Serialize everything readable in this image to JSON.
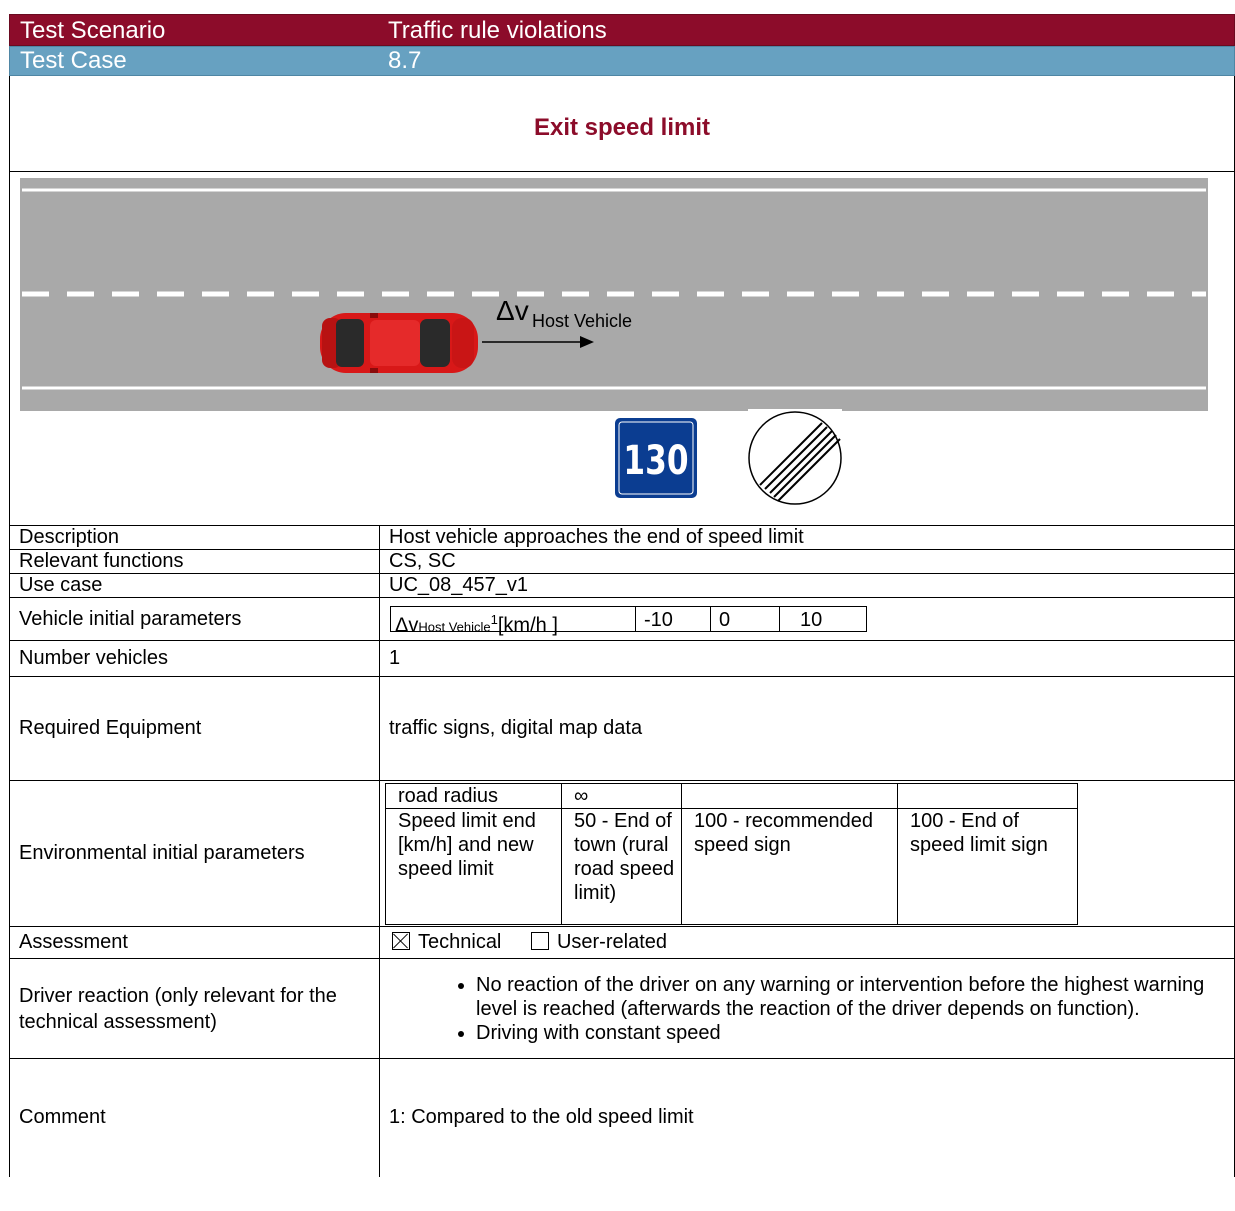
{
  "header": {
    "scenario_label": "Test Scenario",
    "scenario_value": "Traffic rule violations",
    "case_label": "Test Case",
    "case_value": "8.7"
  },
  "title": "Exit speed limit",
  "figure": {
    "velocity_symbol": "Δv",
    "velocity_subscript": "Host Vehicle",
    "sign_speed": "130"
  },
  "rows": {
    "description": {
      "label": "Description",
      "value": "Host vehicle approaches the end of speed limit"
    },
    "relevant_functions": {
      "label": "Relevant functions",
      "value": "CS, SC"
    },
    "use_case": {
      "label": "Use case",
      "value": "UC_08_457_v1"
    },
    "vehicle_params": {
      "label": "Vehicle initial parameters",
      "param_symbol": "Δv",
      "param_subscript": "Host Vehicle",
      "param_footnote": "1",
      "param_unit": "[km/h ]",
      "values": [
        "-10",
        "0",
        "10"
      ]
    },
    "number_vehicles": {
      "label": "Number vehicles",
      "value": "1"
    },
    "required_equipment": {
      "label": "Required Equipment",
      "value": "traffic signs, digital map data"
    },
    "environmental": {
      "label": "Environmental initial parameters",
      "road_radius_label": "road radius",
      "road_radius_value": "∞",
      "speed_label": "Speed limit end [km/h] and new speed limit",
      "speed_values": [
        "50 - End of town (rural road speed limit)",
        "100 - recommended speed sign",
        "100 - End of speed limit sign"
      ]
    },
    "assessment": {
      "label": "Assessment",
      "technical": "Technical",
      "technical_checked": true,
      "user_related": "User-related",
      "user_related_checked": false
    },
    "driver_reaction": {
      "label": "Driver reaction (only relevant for the technical assessment)",
      "bullets": [
        "No reaction of the driver on any warning or intervention before the highest warning level is reached (afterwards the reaction of the driver depends on function).",
        "Driving with constant speed"
      ]
    },
    "comment": {
      "label": "Comment",
      "value": "1: Compared to the old speed limit"
    }
  },
  "colors": {
    "scenario_bg": "#8c0c2a",
    "case_bg": "#67a1c1",
    "title_color": "#8c0c2a",
    "road": "#a9a9a9",
    "car": "#e01b1b",
    "sign_blue": "#0b3d91"
  }
}
